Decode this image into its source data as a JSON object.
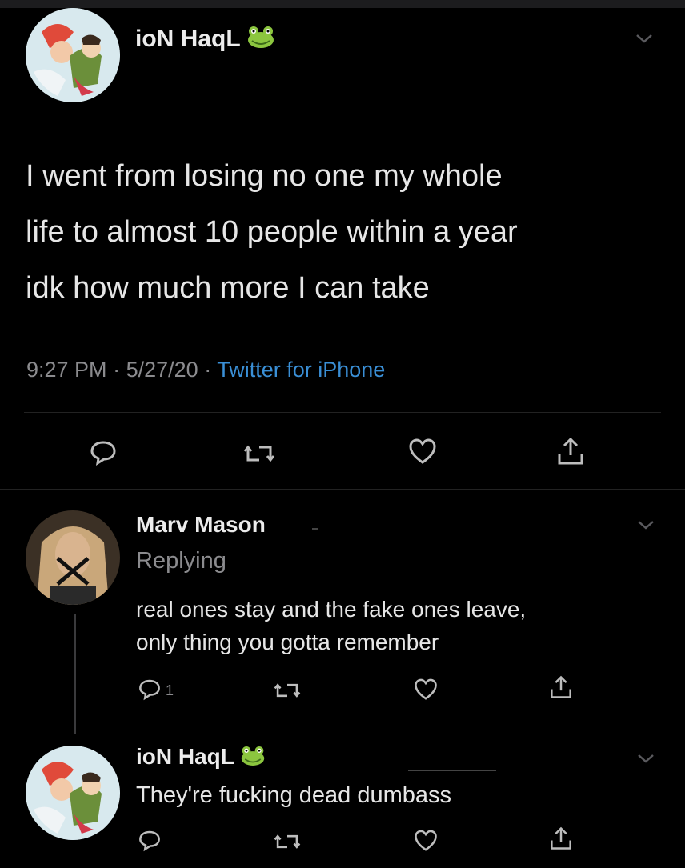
{
  "tweet": {
    "author": "ioN HaqL",
    "author_emoji": "frog-emoji",
    "text_lines": [
      "I went from losing no one my whole",
      "life to almost 10 people within a year",
      "idk how much more I can take"
    ],
    "time": "9:27 PM",
    "date": "5/27/20",
    "source": "Twitter for iPhone",
    "separator": "·"
  },
  "reply1": {
    "author": "Marv Mason",
    "replying_label": "Replying",
    "text_lines": [
      "real ones stay and the fake ones leave,",
      "only thing you gotta remember"
    ],
    "reply_count": "1"
  },
  "reply2": {
    "author": "ioN HaqL",
    "author_emoji": "frog-emoji",
    "text": "They're fucking dead dumbass"
  },
  "colors": {
    "background": "#000000",
    "text": "#e6e6e6",
    "muted": "#8b8b8e",
    "link": "#3a8fd6"
  }
}
